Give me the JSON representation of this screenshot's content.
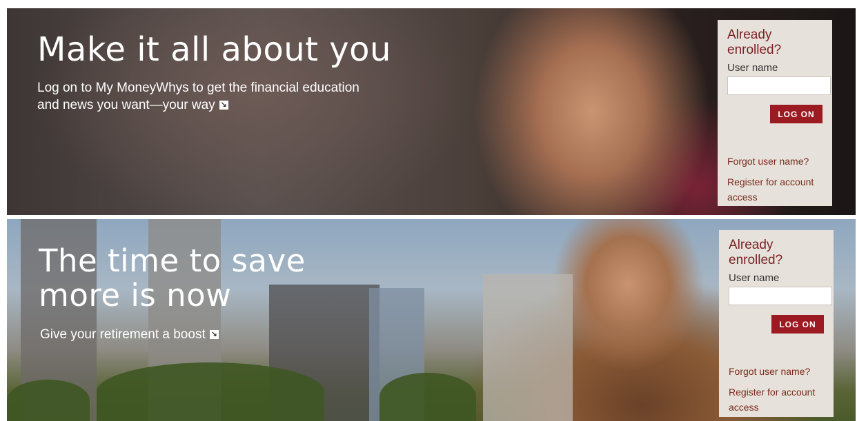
{
  "banners": [
    {
      "headline": "Make it all about you",
      "subline": "Log on to My MoneyWhys to get the financial education and news you want—your way",
      "login": {
        "title": "Already enrolled?",
        "username_label": "User name",
        "username_value": "",
        "logon_button": "LOG ON",
        "forgot_link": "Forgot user name?",
        "register_link": "Register for account access"
      }
    },
    {
      "headline": "The time to save more is now",
      "subline": "Give your retirement a boost",
      "login": {
        "title": "Already enrolled?",
        "username_label": "User name",
        "username_value": "",
        "logon_button": "LOG ON",
        "forgot_link": "Forgot user name?",
        "register_link": "Register for account access"
      }
    }
  ],
  "icons": {
    "arrow": "arrow-corner-icon",
    "glyph": "↘"
  },
  "colors": {
    "panel_background": "#e6e1da",
    "panel_title": "#7a1f22",
    "button": "#9c1b22",
    "link": "#7a2a1c"
  }
}
